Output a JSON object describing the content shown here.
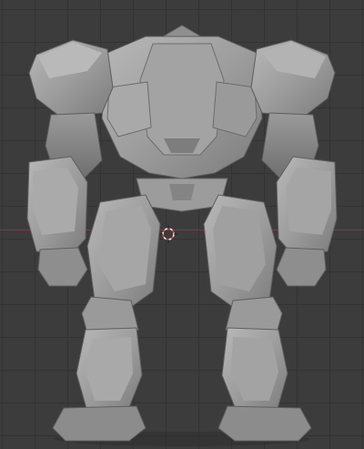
{
  "viewport": {
    "background_color": "#3c3c3c",
    "grid_color": "#333333",
    "x_axis_color": "#8a3a44",
    "model_base_color": "#9b9b9b",
    "model_light_color": "#b5b5b5",
    "model_shadow_color": "#7a7a7a",
    "object": "mech-robot-mesh",
    "view": "back"
  },
  "cursor": {
    "icon": "3d-cursor-icon",
    "ring_colors": [
      "#d24a3a",
      "#eeeeee"
    ]
  }
}
